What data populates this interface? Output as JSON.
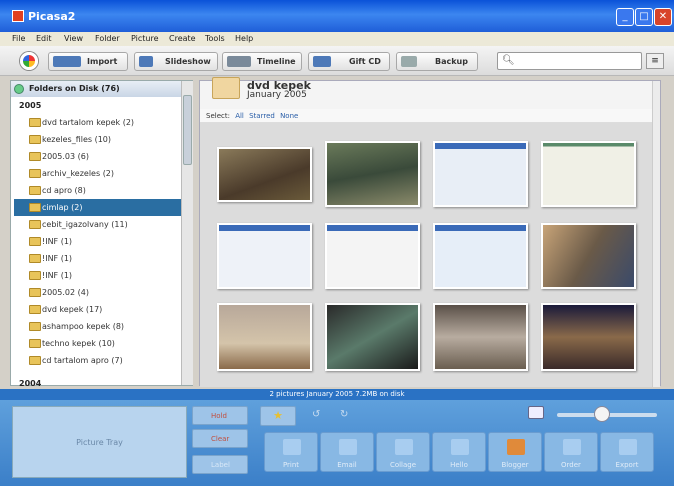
{
  "window": {
    "title": "Picasa2",
    "min": "_",
    "max": "□",
    "close": "✕"
  },
  "menu": [
    "File",
    "Edit",
    "View",
    "Folder",
    "Picture",
    "Create",
    "Tools",
    "Help"
  ],
  "toolbar": {
    "import": "Import",
    "slideshow": "Slideshow",
    "timeline": "Timeline",
    "giftcd": "Gift CD",
    "backup": "Backup",
    "clear": "≡"
  },
  "search": {
    "icon": "search-icon"
  },
  "sidebar": {
    "header": "Folders on Disk (76)",
    "year": "2005",
    "year_next": "2004",
    "folders": [
      "dvd tartalom kepek (2)",
      "kezeles_files (10)",
      "2005.03 (6)",
      "archiv_kezeles (2)",
      "cd apro (8)",
      "cimlap (2)",
      "cebit_igazolvany (11)",
      "!INF (1)",
      "!INF (1)",
      "!INF (1)",
      "2005.02 (4)",
      "dvd kepek (17)",
      "ashampoo kepek (8)",
      "techno kepek (10)",
      "cd tartalom apro (7)"
    ],
    "selected_index": 5
  },
  "album": {
    "title": "dvd kepek",
    "date": "January 2005"
  },
  "selectbar": {
    "label": "Select:",
    "all": "All",
    "starred": "Starred",
    "none": "None"
  },
  "status": {
    "text": "2 pictures    January 2005    7.2MB on disk"
  },
  "tray": {
    "label": "Picture Tray",
    "hold": "Hold",
    "clear": "Clear",
    "label_btn": "Label"
  },
  "actions": [
    "Print",
    "Email",
    "Collage",
    "Hello",
    "Blogger",
    "Order",
    "Export"
  ],
  "colors": {
    "accent": "#2a6ea2",
    "status": "#2a72c4",
    "bottom": "#4a8ed4"
  }
}
